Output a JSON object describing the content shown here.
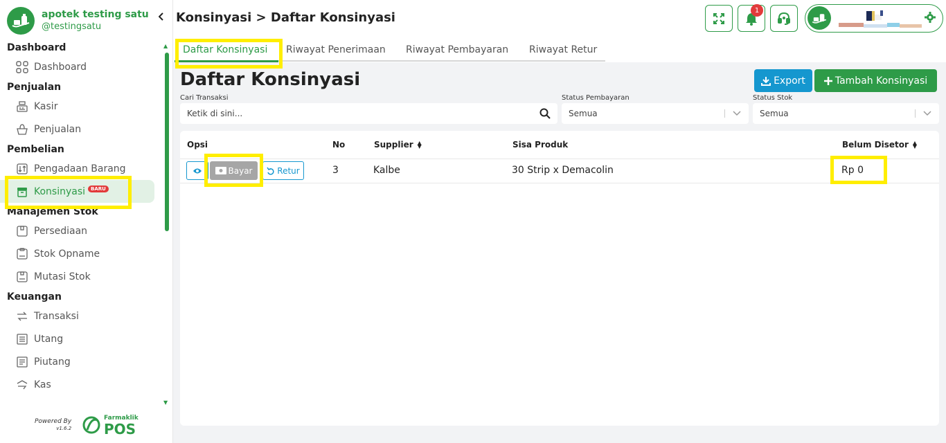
{
  "colors": {
    "primary": "#2e9b48",
    "info": "#1597cf",
    "danger": "#e23b3b",
    "highlight": "#ffee00"
  },
  "brand": {
    "name": "apotek testing satu",
    "handle": "@testingsatu"
  },
  "sidebar": {
    "sections": [
      {
        "title": "Dashboard",
        "items": [
          {
            "label": "Dashboard",
            "icon": "grid-icon"
          }
        ]
      },
      {
        "title": "Penjualan",
        "items": [
          {
            "label": "Kasir",
            "icon": "cash-register-icon"
          },
          {
            "label": "Penjualan",
            "icon": "basket-icon"
          }
        ]
      },
      {
        "title": "Pembelian",
        "items": [
          {
            "label": "Pengadaan Barang",
            "icon": "procurement-icon"
          },
          {
            "label": "Konsinyasi",
            "icon": "box-icon",
            "badge": "BARU",
            "active": true
          }
        ]
      },
      {
        "title": "Manajemen Stok",
        "items": [
          {
            "label": "Persediaan",
            "icon": "package-icon"
          },
          {
            "label": "Stok Opname",
            "icon": "clipboard-icon"
          },
          {
            "label": "Mutasi Stok",
            "icon": "transfer-box-icon"
          }
        ]
      },
      {
        "title": "Keuangan",
        "items": [
          {
            "label": "Transaksi",
            "icon": "exchange-icon"
          },
          {
            "label": "Utang",
            "icon": "ledger-icon"
          },
          {
            "label": "Piutang",
            "icon": "receivable-icon"
          },
          {
            "label": "Kas",
            "icon": "cash-icon"
          }
        ]
      }
    ],
    "powered_by": "Powered By",
    "version": "v1.6.2",
    "footer_brand_small": "Farmaklik",
    "footer_brand_big": "POS"
  },
  "header": {
    "breadcrumb": "Konsinyasi > Daftar Konsinyasi",
    "notification_count": "1"
  },
  "tabs": [
    {
      "label": "Daftar Konsinyasi",
      "active": true
    },
    {
      "label": "Riwayat Penerimaan"
    },
    {
      "label": "Riwayat Pembayaran"
    },
    {
      "label": "Riwayat Retur"
    }
  ],
  "main": {
    "title": "Daftar Konsinyasi",
    "export_label": "Export",
    "add_label": "Tambah Konsinyasi",
    "search": {
      "label": "Cari Transaksi",
      "placeholder": "Ketik di sini..."
    },
    "status_pembayaran": {
      "label": "Status Pembayaran",
      "value": "Semua"
    },
    "status_stok": {
      "label": "Status Stok",
      "value": "Semua"
    }
  },
  "table": {
    "columns": [
      "Opsi",
      "No",
      "Supplier",
      "Sisa Produk",
      "Belum Disetor"
    ],
    "rows": [
      {
        "no": "3",
        "supplier": "Kalbe",
        "sisa_produk": "30 Strip x Demacolin",
        "belum_disetor": "Rp 0",
        "bayar_label": "Bayar",
        "retur_label": "Retur"
      }
    ]
  }
}
